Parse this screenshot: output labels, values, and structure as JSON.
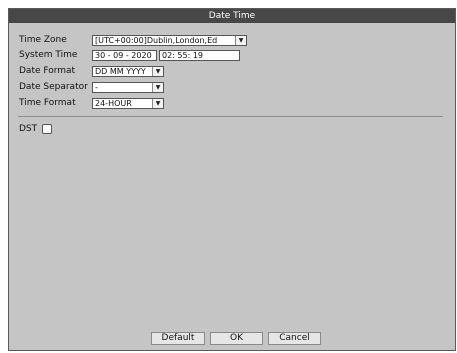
{
  "window": {
    "title": "Date Time"
  },
  "fields": {
    "time_zone": {
      "label": "Time Zone",
      "value": "[UTC+00:00]Dublin,London,Ed"
    },
    "system_time": {
      "label": "System Time",
      "date": "30 - 09 - 2020",
      "time": "02: 55: 19"
    },
    "date_format": {
      "label": "Date Format",
      "value": "DD MM YYYY"
    },
    "date_separator": {
      "label": "Date Separator",
      "value": "-"
    },
    "time_format": {
      "label": "Time Format",
      "value": "24-HOUR"
    }
  },
  "dst": {
    "label": "DST",
    "checked": false
  },
  "buttons": {
    "default": "Default",
    "ok": "OK",
    "cancel": "Cancel"
  },
  "icons": {
    "dropdown": "chevron-down-icon"
  },
  "colors": {
    "titlebar": "#474747",
    "panel": "#c5c5c5"
  }
}
